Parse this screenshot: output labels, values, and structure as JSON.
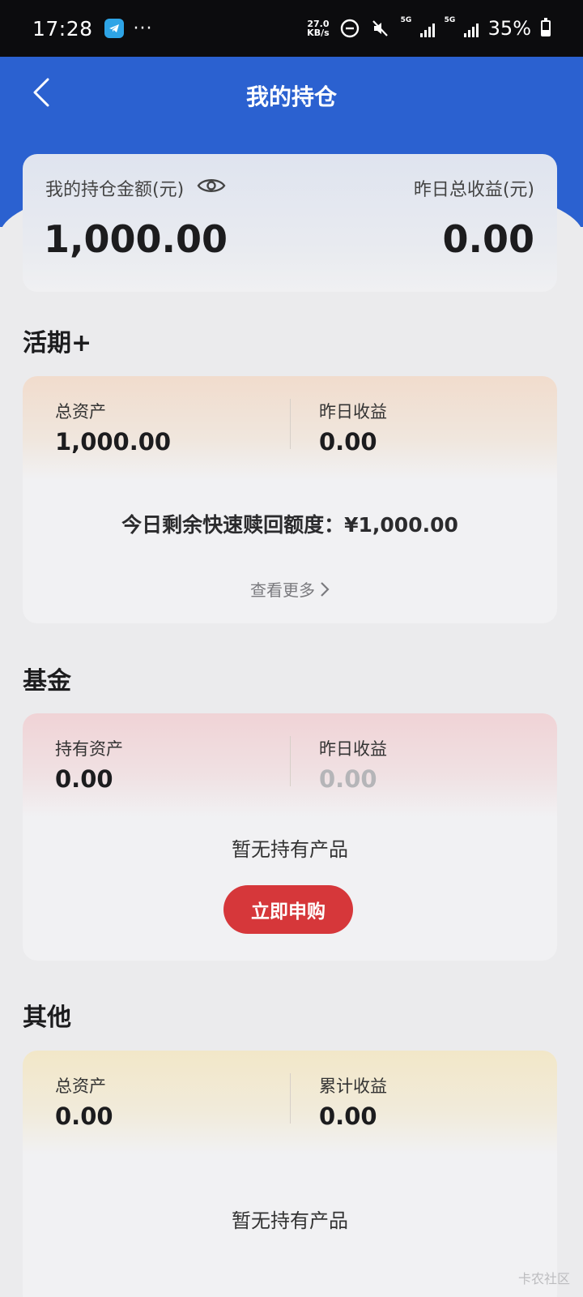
{
  "status_bar": {
    "time": "17:28",
    "more": "···",
    "speed_top": "27.0",
    "speed_bottom": "KB/s",
    "sig1": "5G",
    "sig2": "5G",
    "battery": "35%"
  },
  "header": {
    "title": "我的持仓"
  },
  "summary": {
    "holding_label": "我的持仓金额(元)",
    "holding_value": "1,000.00",
    "yesterday_label": "昨日总收益(元)",
    "yesterday_value": "0.00"
  },
  "sections": {
    "current": {
      "title": "活期+",
      "left_label": "总资产",
      "left_value": "1,000.00",
      "right_label": "昨日收益",
      "right_value": "0.00",
      "quota_text": "今日剩余快速赎回额度：¥1,000.00",
      "more_label": "查看更多"
    },
    "fund": {
      "title": "基金",
      "left_label": "持有资产",
      "left_value": "0.00",
      "right_label": "昨日收益",
      "right_value": "0.00",
      "empty_text": "暂无持有产品",
      "buy_label": "立即申购"
    },
    "other": {
      "title": "其他",
      "left_label": "总资产",
      "left_value": "0.00",
      "right_label": "累计收益",
      "right_value": "0.00",
      "empty_text": "暂无持有产品"
    }
  },
  "watermark": "卡农社区",
  "colors": {
    "header_blue": "#2b61d0",
    "buy_red": "#d6373a"
  }
}
